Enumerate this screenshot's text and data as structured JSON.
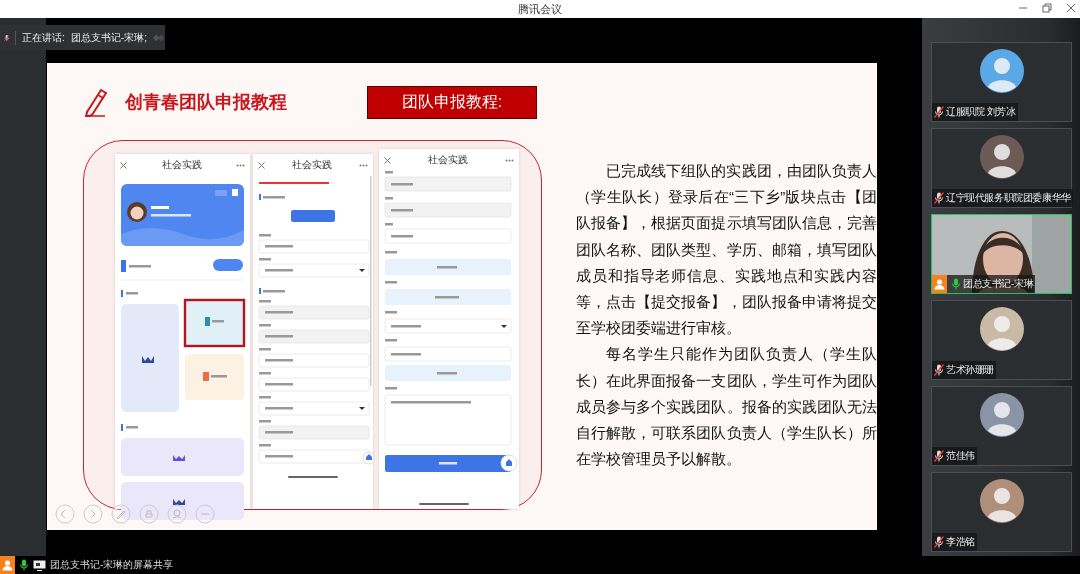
{
  "window": {
    "title": "腾讯会议"
  },
  "speaking": {
    "label": "正在讲话:",
    "speaker": "团总支书记-宋琳;"
  },
  "slide": {
    "title": "创青春团队申报教程",
    "tag": "团队申报教程:",
    "phones": [
      {
        "kind": "home",
        "title": "社会实践"
      },
      {
        "kind": "form",
        "title": "社会实践"
      },
      {
        "kind": "submit",
        "title": "社会实践"
      }
    ],
    "paragraphs": [
      "已完成线下组队的实践团，由团队负责人（学生队长）登录后在“三下乡”版块点击【团队报备】，根据页面提示填写团队信息，完善团队名称、团队类型、学历、邮箱，填写团队成员和指导老师信息、实践地点和实践内容等，点击【提交报备】，团队报备申请将提交至学校团委端进行审核。",
      "每名学生只能作为团队负责人（学生队长）在此界面报备一支团队，学生可作为团队成员参与多个实践团队。报备的实践团队无法自行解散，可联系团队负责人（学生队长）所在学校管理员予以解散。"
    ]
  },
  "participants": [
    {
      "name": "辽服职院 刘芳冰",
      "kind": "avatar",
      "muted": true,
      "active": false,
      "sharing": false
    },
    {
      "name": "辽宁现代服务职院团委康华华",
      "kind": "avatar",
      "muted": true,
      "active": false,
      "sharing": false
    },
    {
      "name": "团总支书记-宋琳",
      "kind": "video",
      "muted": false,
      "active": true,
      "sharing": true
    },
    {
      "name": "艺术孙珊珊",
      "kind": "avatar",
      "muted": true,
      "active": false,
      "sharing": false
    },
    {
      "name": "范佳伟",
      "kind": "avatar",
      "muted": true,
      "active": false,
      "sharing": false
    },
    {
      "name": "李浩铭",
      "kind": "avatar",
      "muted": true,
      "active": false,
      "sharing": false
    }
  ],
  "status_bar": {
    "text": "团总支书记-宋琳的屏幕共享",
    "muted": false,
    "sharing": true
  }
}
